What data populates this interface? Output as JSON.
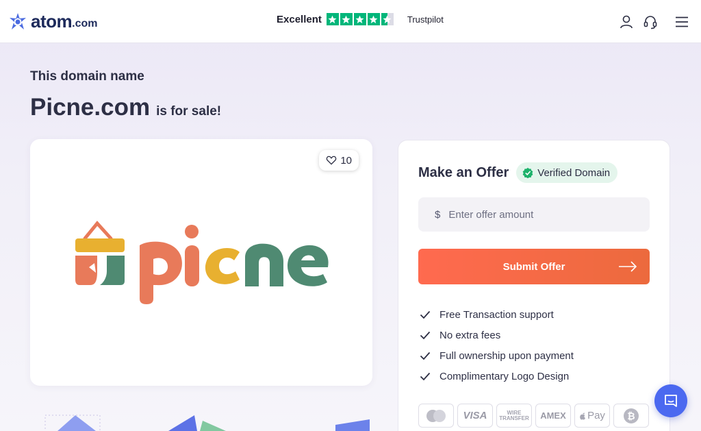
{
  "header": {
    "logo_text": "atom",
    "logo_suffix": ".com",
    "trust_label": "Excellent",
    "trust_name": "Trustpilot",
    "trust_rating": 4.5,
    "icons": [
      "user-icon",
      "headset-icon",
      "menu-icon"
    ]
  },
  "hero": {
    "eyebrow": "This domain name",
    "domain": "Picne.com",
    "suffix": "is for sale!"
  },
  "logo_card": {
    "likes": "10",
    "brand_word": "picne",
    "brand_colors": [
      "#e87a5a",
      "#e8b030",
      "#4f8a72"
    ]
  },
  "offer": {
    "title": "Make an Offer",
    "verified_label": "Verified Domain",
    "currency": "$",
    "amount_placeholder": "Enter offer amount",
    "submit_label": "Submit Offer",
    "features": [
      "Free Transaction support",
      "No extra fees",
      "Full ownership upon payment",
      "Complimentary Logo Design"
    ],
    "payments": [
      "Mastercard",
      "VISA",
      "WIRE TRANSFER",
      "AMEX",
      "Pay",
      "Bitcoin"
    ]
  },
  "colors": {
    "accent": "#ff6a4f",
    "brand": "#1d2a5b",
    "trust_green": "#00b67a",
    "chat": "#4b69f0"
  }
}
